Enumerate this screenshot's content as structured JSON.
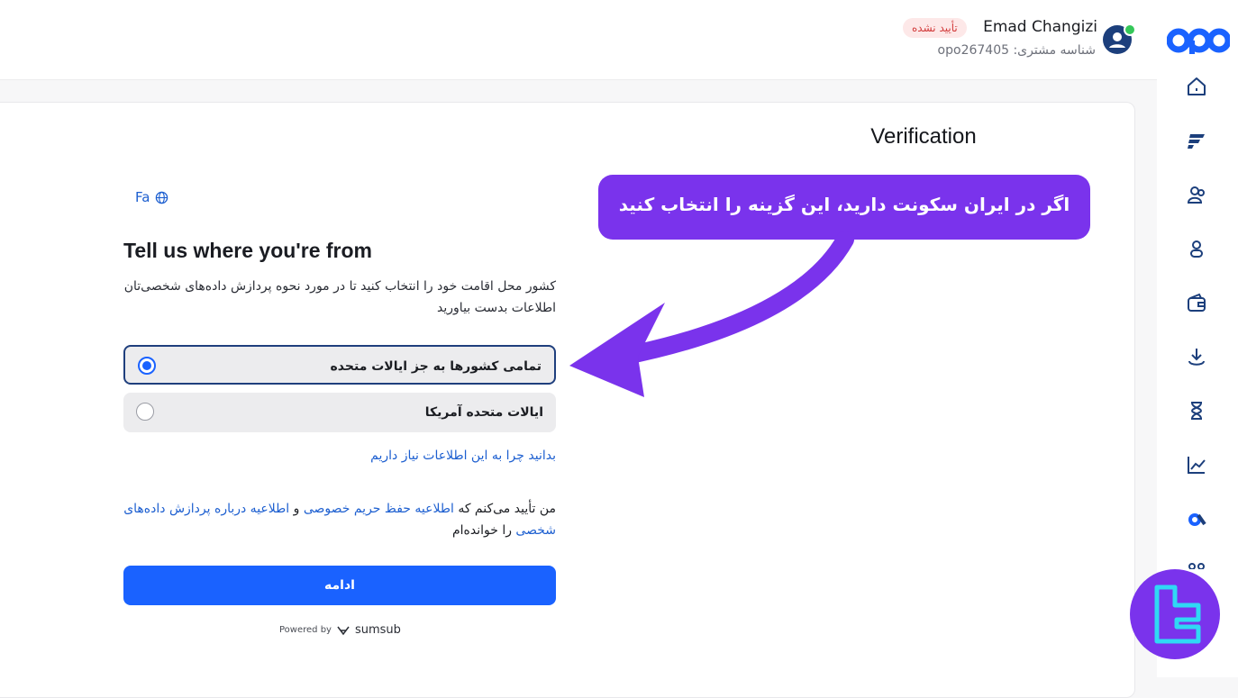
{
  "header": {
    "user_name": "Emad Changizi",
    "status_badge": "تأیید نشده",
    "customer_id_label": "شناسه مشتری:",
    "customer_id": "opo267405"
  },
  "brand": {
    "logo_text": "opo",
    "accent": "#1a62ff"
  },
  "sidebar": {
    "icons": [
      "home-icon",
      "flash-icon",
      "users-icon",
      "user-icon",
      "wallet-icon",
      "download-icon",
      "hourglass-icon",
      "chart-icon",
      "logo-mark-icon",
      "partners-icon"
    ]
  },
  "page": {
    "title": "Verification",
    "language": "Fa",
    "heading": "Tell us where you're from",
    "subtext": "کشور محل اقامت خود را انتخاب کنید تا در مورد نحوه پردازش داده‌های شخصی‌تان اطلاعات بدست بیاورید",
    "options": [
      {
        "label": "تمامی کشورها به جز ایالات متحده",
        "selected": true
      },
      {
        "label": "ایالات متحده آمریکا",
        "selected": false
      }
    ],
    "why_link": "بدانید چرا به این اطلاعات نیاز داریم",
    "consent": {
      "prefix": "من تأیید می‌کنم که",
      "privacy_link": "اطلاعیه حفظ حریم خصوصی",
      "and": "و",
      "processing_link": "اطلاعیه درباره پردازش داده‌های شخصی",
      "suffix": "را خوانده‌ام"
    },
    "continue_button": "ادامه",
    "powered_by": "Powered by",
    "powered_brand": "sumsub"
  },
  "annotation": {
    "callout_text": "اگر در ایران سکونت دارید، این گزینه را انتخاب کنید",
    "color": "#7a33ec"
  }
}
